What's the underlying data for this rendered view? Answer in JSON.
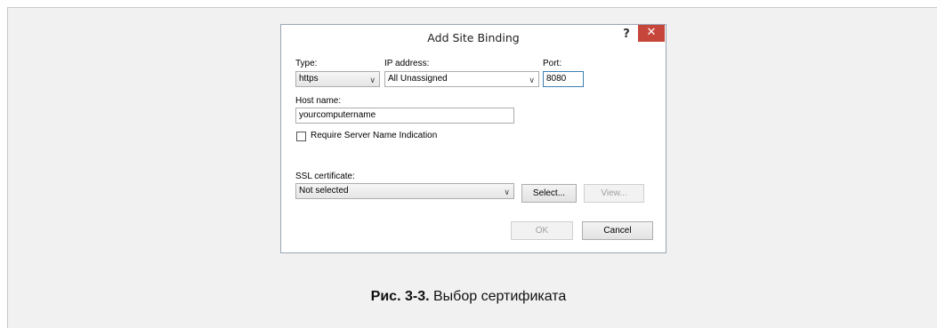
{
  "dialog": {
    "title": "Add Site Binding",
    "help": "?",
    "close": "✕"
  },
  "type": {
    "label": "Type:",
    "value": "https"
  },
  "ip": {
    "label": "IP address:",
    "value": "All Unassigned"
  },
  "port": {
    "label": "Port:",
    "value": "8080"
  },
  "host": {
    "label": "Host name:",
    "value": "yourcomputername"
  },
  "sni": {
    "label": "Require Server Name Indication",
    "checked": false
  },
  "ssl": {
    "label": "SSL certificate:",
    "value": "Not selected"
  },
  "buttons": {
    "select": "Select...",
    "view": "View...",
    "ok": "OK",
    "cancel": "Cancel"
  },
  "caption": {
    "prefix": "Рис. 3-3.",
    "text": " Выбор сертификата"
  },
  "icons": {
    "caret": "∨"
  }
}
